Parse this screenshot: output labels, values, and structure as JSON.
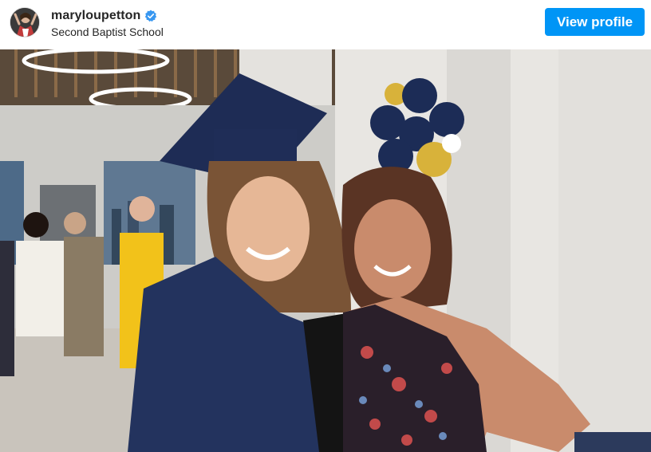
{
  "header": {
    "username": "maryloupetton",
    "verified": true,
    "location": "Second Baptist School",
    "avatar_icon": "profile-avatar",
    "verified_icon": "verified-badge-icon",
    "view_profile_label": "View profile"
  },
  "colors": {
    "accent": "#0095f6",
    "verified": "#3897f0",
    "text": "#262626"
  },
  "photo": {
    "subject": "graduation-photo"
  }
}
